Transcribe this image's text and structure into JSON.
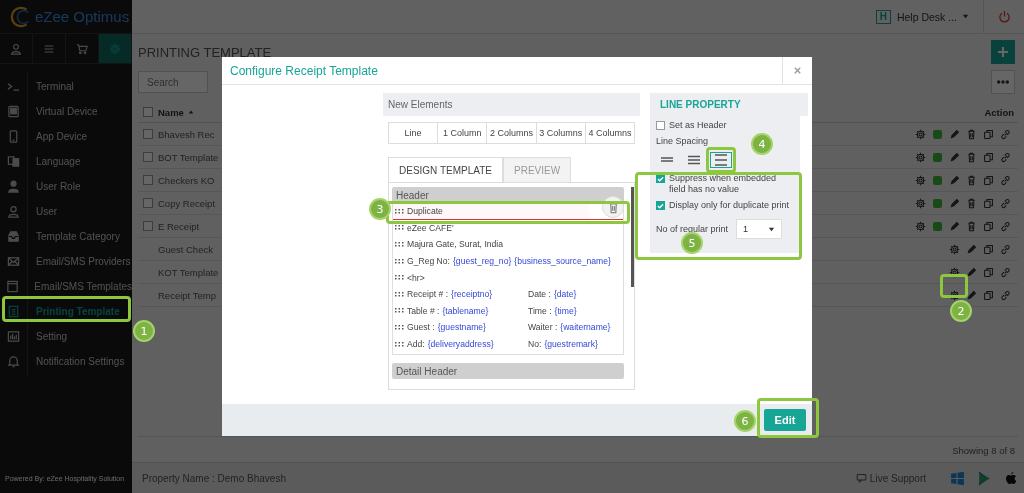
{
  "sidebar": {
    "logo": "eZee Optimus",
    "tabs": [
      {
        "selected": false
      },
      {
        "selected": false
      },
      {
        "selected": false
      },
      {
        "selected": true
      }
    ],
    "items": [
      {
        "label": "Terminal",
        "selected": false
      },
      {
        "label": "Virtual Device",
        "selected": false
      },
      {
        "label": "App Device",
        "selected": false
      },
      {
        "label": "Language",
        "selected": false
      },
      {
        "label": "User Role",
        "selected": false
      },
      {
        "label": "User",
        "selected": false
      },
      {
        "label": "Template Category",
        "selected": false
      },
      {
        "label": "Email/SMS Providers",
        "selected": false
      },
      {
        "label": "Email/SMS Templates",
        "selected": false
      },
      {
        "label": "Printing Template",
        "selected": true
      },
      {
        "label": "Setting",
        "selected": false
      },
      {
        "label": "Notification Settings",
        "selected": false
      }
    ],
    "footer": "Powered By: eZee Hospitality Solution"
  },
  "topbar": {
    "badge": "H",
    "user": "Help Desk ..."
  },
  "page": {
    "title": "PRINTING TEMPLATE",
    "search": {
      "placeholder": "Search"
    },
    "table": {
      "columns": [
        "Name",
        "Action"
      ],
      "all_checked": false,
      "rows": [
        {
          "name": "Bhavesh Rec",
          "kind": "custom",
          "checked": false
        },
        {
          "name": "BOT Template",
          "kind": "custom",
          "checked": false
        },
        {
          "name": "Checkers KO",
          "kind": "custom",
          "checked": false
        },
        {
          "name": "Copy Receipt",
          "kind": "custom",
          "checked": false
        },
        {
          "name": "E Receipt",
          "kind": "custom",
          "checked": false
        },
        {
          "name": "Guest Check",
          "kind": "default"
        },
        {
          "name": "KOT Template",
          "kind": "default"
        },
        {
          "name": "Receipt Temp",
          "kind": "default"
        }
      ]
    },
    "showing": "Showing 8 of 8"
  },
  "footer": {
    "property": "Property Name : Demo Bhavesh",
    "support": "Live Support"
  },
  "modal": {
    "title": "Configure Receipt Template",
    "new_elements": {
      "title": "New Elements",
      "buttons": [
        "Line",
        "1 Column",
        "2 Columns",
        "3 Columns",
        "4 Columns"
      ]
    },
    "tabs": [
      {
        "label": "DESIGN TEMPLATE",
        "selected": true
      },
      {
        "label": "PREVIEW",
        "selected": false
      }
    ],
    "sections": [
      {
        "title": "Header",
        "lines": [
          {
            "selected": true,
            "cells": [
              {
                "label": "Duplicate"
              }
            ]
          },
          {
            "selected": false,
            "cells": [
              {
                "label": "eZee CAFE'"
              }
            ]
          },
          {
            "selected": false,
            "cells": [
              {
                "label": "Majura Gate, Surat, India"
              }
            ]
          },
          {
            "selected": false,
            "cells": [
              {
                "label": "G_Reg No:",
                "fields": [
                  "{guest_reg_no}",
                  "{business_source_name}"
                ]
              }
            ]
          },
          {
            "selected": false,
            "cells": [
              {
                "label": "<hr>"
              }
            ]
          },
          {
            "selected": false,
            "cells": [
              {
                "label": "Receipt # :",
                "fields": [
                  "{receiptno}"
                ]
              },
              {
                "label": "Date :",
                "fields": [
                  "{date}"
                ]
              }
            ]
          },
          {
            "selected": false,
            "cells": [
              {
                "label": "Table # :",
                "fields": [
                  "{tablename}"
                ]
              },
              {
                "label": "Time :",
                "fields": [
                  "{time}"
                ]
              }
            ]
          },
          {
            "selected": false,
            "cells": [
              {
                "label": "Guest :",
                "fields": [
                  "{guestname}"
                ]
              },
              {
                "label": "Waiter :",
                "fields": [
                  "{waitername}"
                ]
              }
            ]
          },
          {
            "selected": false,
            "cells": [
              {
                "label": "Add:",
                "fields": [
                  "{deliveryaddress}"
                ]
              },
              {
                "label": "No:",
                "fields": [
                  "{guestremark}"
                ]
              }
            ]
          }
        ]
      },
      {
        "title": "Detail Header"
      }
    ],
    "properties": {
      "title": "LINE PROPERTY",
      "set_as_header": {
        "label": "Set as Header",
        "checked": false
      },
      "line_spacing": {
        "label": "Line Spacing",
        "options": [
          {
            "selected": false
          },
          {
            "selected": false
          },
          {
            "selected": true
          }
        ]
      },
      "suppress": {
        "label": "Suppress when embedded field has no value",
        "checked": true
      },
      "duplicate_only": {
        "label": "Display only for duplicate print",
        "checked": true
      },
      "regular_print": {
        "label": "No of regular print",
        "value": "1"
      }
    },
    "button": "Edit"
  },
  "callouts": [
    {
      "number": "1"
    },
    {
      "number": "2"
    },
    {
      "number": "3"
    },
    {
      "number": "4"
    },
    {
      "number": "5"
    },
    {
      "number": "6"
    }
  ]
}
